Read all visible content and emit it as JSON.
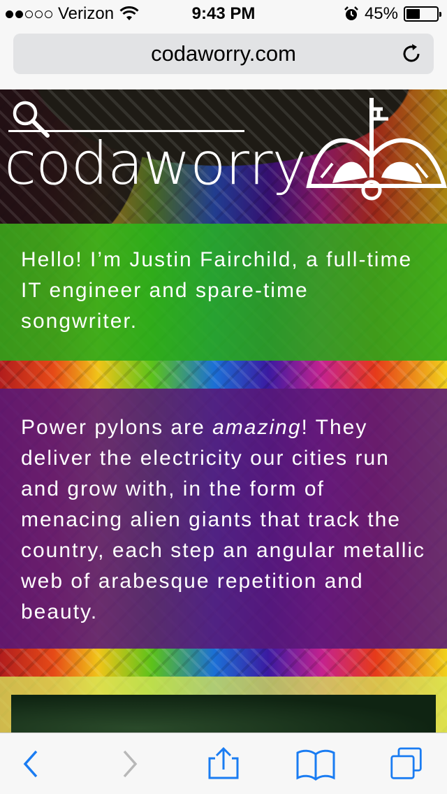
{
  "status_bar": {
    "carrier": "Verizon",
    "signal_bars_filled": 2,
    "signal_bars_total": 5,
    "time": "9:43 PM",
    "battery_percent": "45%",
    "battery_level": 0.45
  },
  "browser": {
    "url": "codaworry.com"
  },
  "page": {
    "logo_text": "codaworry",
    "intro": "Hello! I’m Justin Fairchild, a full-time IT engineer and spare-time songwriter.",
    "pylons_before": "Power pylons are ",
    "pylons_em": "amazing",
    "pylons_after": "! They deliver the electricity our cities run and grow with, in the form of menacing alien giants that track the country, each step an angular metallic web of arabesque repetition and beauty."
  },
  "colors": {
    "accent": "#1a7cf2",
    "green_panel": "#29a91a",
    "purple_panel": "#581878"
  }
}
